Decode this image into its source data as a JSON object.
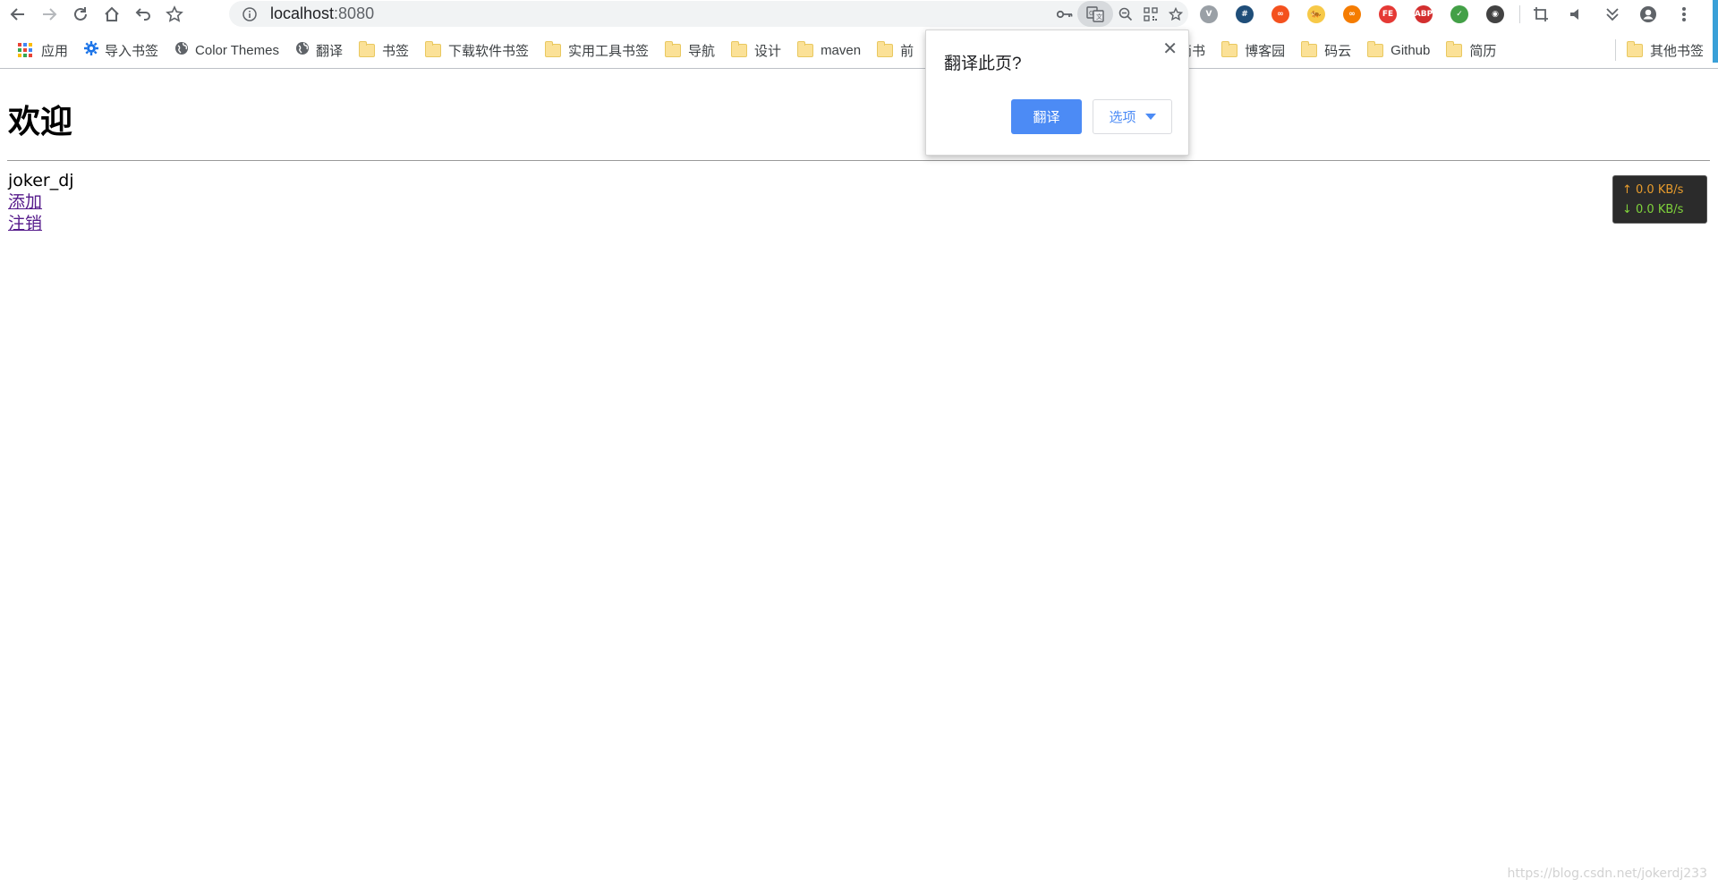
{
  "browser": {
    "url_host": "localhost",
    "url_port": ":8080",
    "nav": {
      "back_icon": "arrow-left-icon",
      "forward_icon": "arrow-right-icon",
      "reload_icon": "reload-icon",
      "home_icon": "home-icon",
      "undo_icon": "undo-icon",
      "star_icon": "star-icon"
    },
    "omnibox_icons": [
      "key-icon",
      "translate-icon",
      "zoom-out-icon",
      "qr-code-icon",
      "bookmark-star-icon"
    ],
    "extensions": [
      {
        "name": "vimeo-v-extension-icon",
        "label": "V",
        "color": "#9aa0a6"
      },
      {
        "name": "hashtag-extension-icon",
        "label": "#",
        "color": "#1f4e79"
      },
      {
        "name": "infinity-red-extension-icon",
        "label": "∞",
        "color": "#f4511e"
      },
      {
        "name": "tiger-extension-icon",
        "label": "🐅",
        "color": "#f7c948"
      },
      {
        "name": "infinity-orange-extension-icon",
        "label": "∞",
        "color": "#f57c00"
      },
      {
        "name": "fe-extension-icon",
        "label": "FE",
        "color": "#e53935"
      },
      {
        "name": "adblock-plus-extension-icon",
        "label": "ABP",
        "color": "#d32f2f"
      },
      {
        "name": "shield-check-extension-icon",
        "label": "✓",
        "color": "#43a047"
      },
      {
        "name": "dark-circle-extension-icon",
        "label": "◉",
        "color": "#424242"
      }
    ],
    "right_icons": [
      "crop-icon",
      "speaker-icon",
      "chevron-double-down-icon",
      "account-icon",
      "menu-dots-icon"
    ]
  },
  "bookmarks": {
    "apps_label": "应用",
    "items": [
      {
        "label": "导入书签",
        "icon": "gear-icon"
      },
      {
        "label": "Color Themes",
        "icon": "globe-icon"
      },
      {
        "label": "翻译",
        "icon": "globe-icon"
      },
      {
        "label": "书签",
        "icon": "folder-icon"
      },
      {
        "label": "下载软件书签",
        "icon": "folder-icon"
      },
      {
        "label": "实用工具书签",
        "icon": "folder-icon"
      },
      {
        "label": "导航",
        "icon": "folder-icon"
      },
      {
        "label": "设计",
        "icon": "folder-icon"
      },
      {
        "label": "maven",
        "icon": "folder-icon"
      },
      {
        "label": "前",
        "icon": "folder-icon"
      }
    ],
    "right_items": [
      {
        "label": "简书",
        "icon": "folder-icon"
      },
      {
        "label": "博客园",
        "icon": "folder-icon"
      },
      {
        "label": "码云",
        "icon": "folder-icon"
      },
      {
        "label": "Github",
        "icon": "folder-icon"
      },
      {
        "label": "简历",
        "icon": "folder-icon"
      }
    ],
    "other_label": "其他书签"
  },
  "page": {
    "title": "欢迎",
    "username": "joker_dj",
    "link_add": "添加",
    "link_logout": "注销"
  },
  "translate_popup": {
    "question": "翻译此页?",
    "translate_button": "翻译",
    "options_button": "选项"
  },
  "netspeed": {
    "up": "↑ 0.0 KB/s",
    "down": "↓ 0.0 KB/s"
  },
  "watermark": "https://blog.csdn.net/jokerdj233"
}
